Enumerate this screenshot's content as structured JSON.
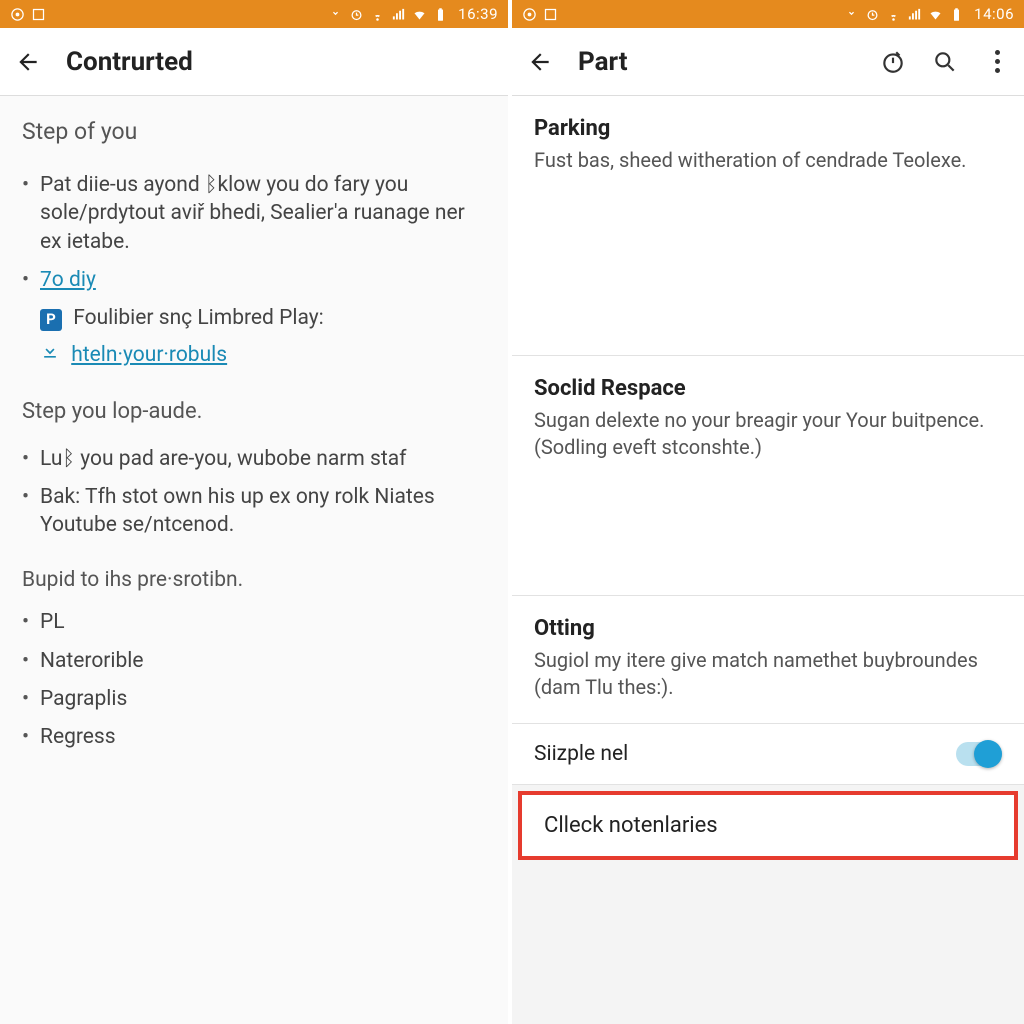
{
  "left": {
    "status": {
      "time": "16:39"
    },
    "appbar": {
      "title": "Contrurted"
    },
    "section1_heading": "Step of you",
    "bullet1": "Pat diie-us ayond ᛒklow you do fary you sole/prdytout aviř bhedi, Sealier'a ruanage ner ex ietabe.",
    "link1": "7o diy",
    "line_p_label": "Foulibier snç Limbred Play:",
    "link2": "hteln·your·robuls",
    "section2_heading": "Step you lop-aude.",
    "bullet2a": "Luᛒ you pad are-you, wubobe narm staf",
    "bullet2b": "Bak: Tfh stot own his up ex ony rolk Niates Youtube se/ntcenod.",
    "footer": "Bupid to ihs pre·srotibn.",
    "small": [
      "PL",
      "Naterorible",
      "Pagraplis",
      "Regress"
    ]
  },
  "right": {
    "status": {
      "time": "14:06"
    },
    "appbar": {
      "title": "Part"
    },
    "cards": [
      {
        "title": "Parking",
        "body": "Fust bas, sheed witheration of cendrade Teolexe."
      },
      {
        "title": "Soclid Respace",
        "body": "Sugan delexte no your breagir your Your buitpence. (Sodling eveft stconshte.)"
      },
      {
        "title": "Otting",
        "body": "Sugiol my itere give match namethet buybroundes (dam Tlu thes:)."
      }
    ],
    "toggle": {
      "label": "Siizple nel",
      "on": true
    },
    "highlight": "Clleck notenlaries"
  }
}
